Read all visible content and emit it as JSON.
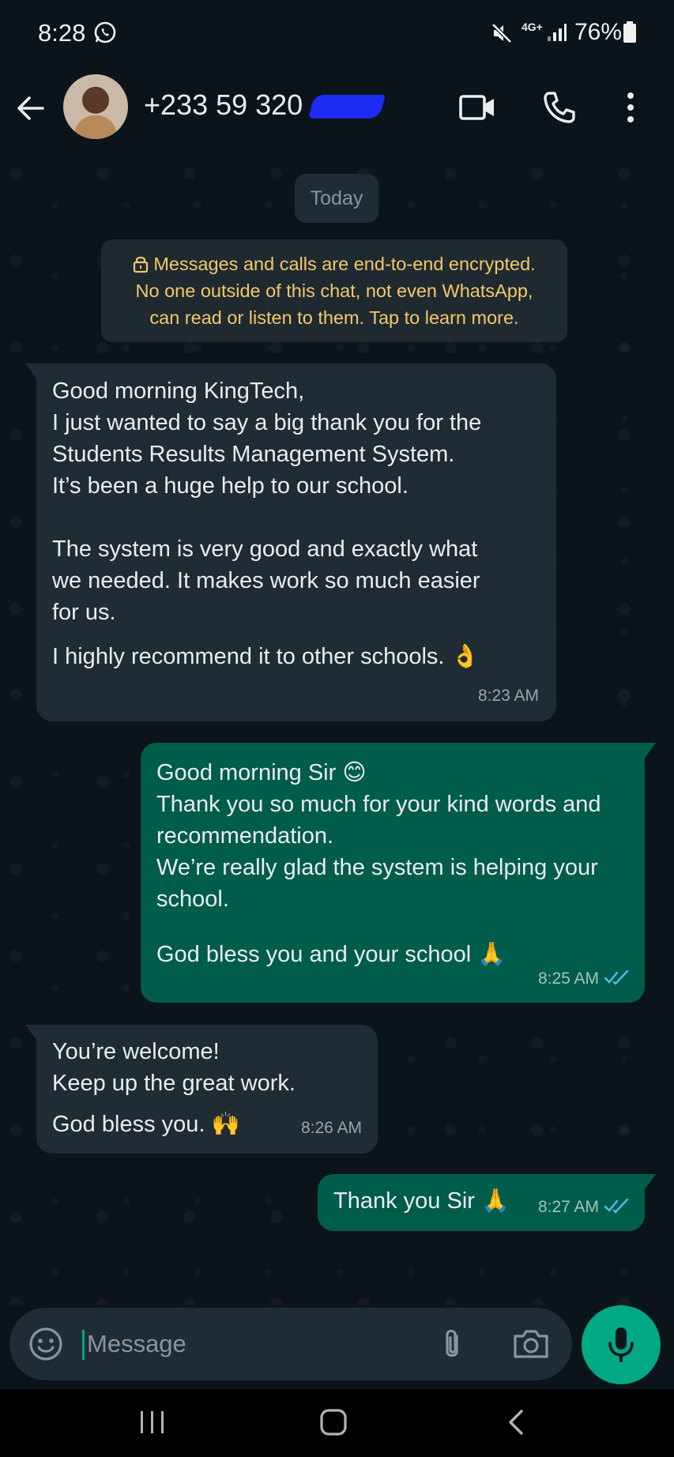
{
  "status_bar": {
    "time": "8:28",
    "network": "4G+",
    "battery": "76%"
  },
  "header": {
    "contact": "+233 59 320"
  },
  "chat": {
    "date_chip": "Today",
    "encryption_notice": [
      "Messages and calls are end-to-end encrypted.",
      "No one outside of this chat, not even WhatsApp,",
      "can read or listen to them. Tap to learn more."
    ],
    "messages": [
      {
        "direction": "in",
        "lines": [
          "Good morning KingTech,",
          "I just wanted to say a big thank you for the",
          "Students Results Management System.",
          "It’s been a huge help to our school.",
          "",
          "The system is very good and exactly what",
          "we needed. It makes work so much easier",
          "for us."
        ],
        "last_line": "I highly recommend it to other schools. 👌",
        "time": "8:23 AM"
      },
      {
        "direction": "out",
        "lines": [
          "Good morning Sir 😊",
          "Thank you so much for your kind words and",
          "recommendation.",
          "We’re really glad the system is helping your",
          "school.",
          ""
        ],
        "last_line": "God bless you and your school 🙏",
        "time": "8:25 AM",
        "status": "read"
      },
      {
        "direction": "in",
        "lines": [
          "You’re welcome!",
          "Keep up the great work."
        ],
        "last_line": "God bless you. 🙌",
        "time": "8:26 AM"
      },
      {
        "direction": "out",
        "lines": [],
        "last_line": "Thank you Sir 🙏",
        "time": "8:27 AM",
        "status": "read"
      }
    ]
  },
  "composer": {
    "placeholder": "Message"
  },
  "colors": {
    "background": "#0b141a",
    "incoming_bubble": "#1f2c34",
    "outgoing_bubble": "#005c4b",
    "accent": "#00a884",
    "read_ticks": "#53bdeb",
    "encryption_text": "#f4c869"
  },
  "icons": [
    "whatsapp-icon",
    "mute-icon",
    "signal-icon",
    "battery-icon",
    "back-arrow-icon",
    "video-call-icon",
    "voice-call-icon",
    "more-options-icon",
    "lock-icon",
    "emoji-icon",
    "attach-icon",
    "camera-icon",
    "mic-icon",
    "double-check-icon"
  ]
}
